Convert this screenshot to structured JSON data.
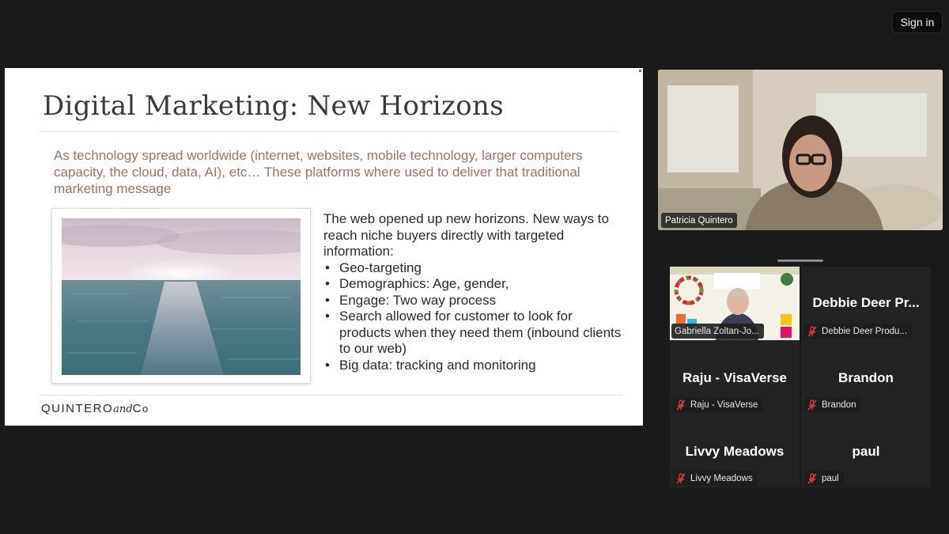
{
  "header": {
    "signin_label": "Sign in"
  },
  "slide": {
    "title": "Digital Marketing: New Horizons",
    "intro": "As technology spread worldwide (internet, websites, mobile technology, larger computers capacity, the cloud, data,  AI), etc… These platforms where used to deliver that traditional marketing message",
    "lead": "The web opened up new horizons. New ways to reach niche buyers directly with targeted information:",
    "bullets": [
      "Geo-targeting",
      "Demographics: Age, gender,",
      "Engage: Two way process",
      "Search allowed for customer to look for products when they need them (inbound clients to our web)",
      "Big data: tracking and monitoring"
    ],
    "logo": {
      "main": "QUINTERO",
      "and": "and",
      "co_c": "C",
      "co_o": "o"
    }
  },
  "speaker": {
    "name": "Patricia Quintero"
  },
  "participants": [
    {
      "display": "",
      "label": "Gabriella Zoltan-Jo...",
      "has_video": true
    },
    {
      "display": "Debbie Deer Pr...",
      "label": "Debbie Deer Produ..."
    },
    {
      "display": "Raju - VisaVerse",
      "label": "Raju - VisaVerse"
    },
    {
      "display": "Brandon",
      "label": "Brandon"
    },
    {
      "display": "Livvy Meadows",
      "label": "Livvy Meadows"
    },
    {
      "display": "paul",
      "label": "paul"
    }
  ],
  "colors": {
    "muted_mic": "#e03b3b",
    "intro_text": "#a36f5e",
    "background": "#1a1a1a"
  }
}
